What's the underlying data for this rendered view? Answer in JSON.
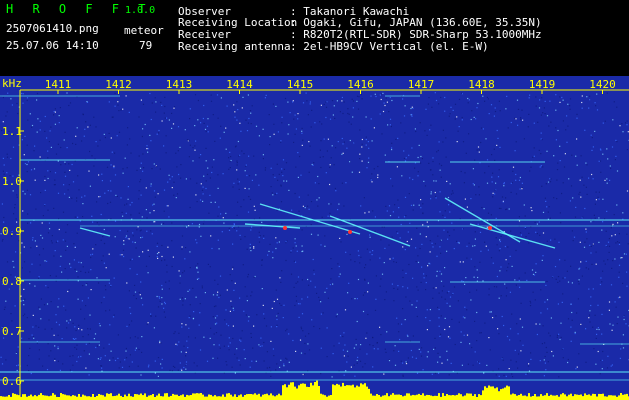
{
  "header": {
    "app_title": "H R O F F T",
    "app_version": "1.0.0",
    "filename": "2507061410.png",
    "datetime": "25.07.06 14:10",
    "meteor_label": "meteor",
    "meteor_count": "79",
    "info": [
      {
        "label": "Observer",
        "value": ": Takanori Kawachi"
      },
      {
        "label": "Receiving Location",
        "value": ": Ogaki, Gifu, JAPAN (136.60E, 35.35N)"
      },
      {
        "label": "Receiver",
        "value": ": R820T2(RTL-SDR) SDR-Sharp 53.1000MHz"
      },
      {
        "label": "Receiving antenna",
        "value": ": 2el-HB9CV Vertical (el. E-W)"
      }
    ]
  },
  "spectrogram": {
    "unit": "kHz",
    "x_ticks": [
      "1411",
      "1412",
      "1413",
      "1414",
      "1415",
      "1416",
      "1417",
      "1418",
      "1419",
      "1420"
    ],
    "y_ticks": [
      "1.1",
      "1.0",
      "0.9",
      "0.8",
      "0.7",
      "0.6"
    ],
    "colors": {
      "background": "#1a2aa8",
      "axis": "#ffff00",
      "signal": "#66ffff",
      "peak": "#ff3333",
      "level": "#ffff00"
    }
  }
}
